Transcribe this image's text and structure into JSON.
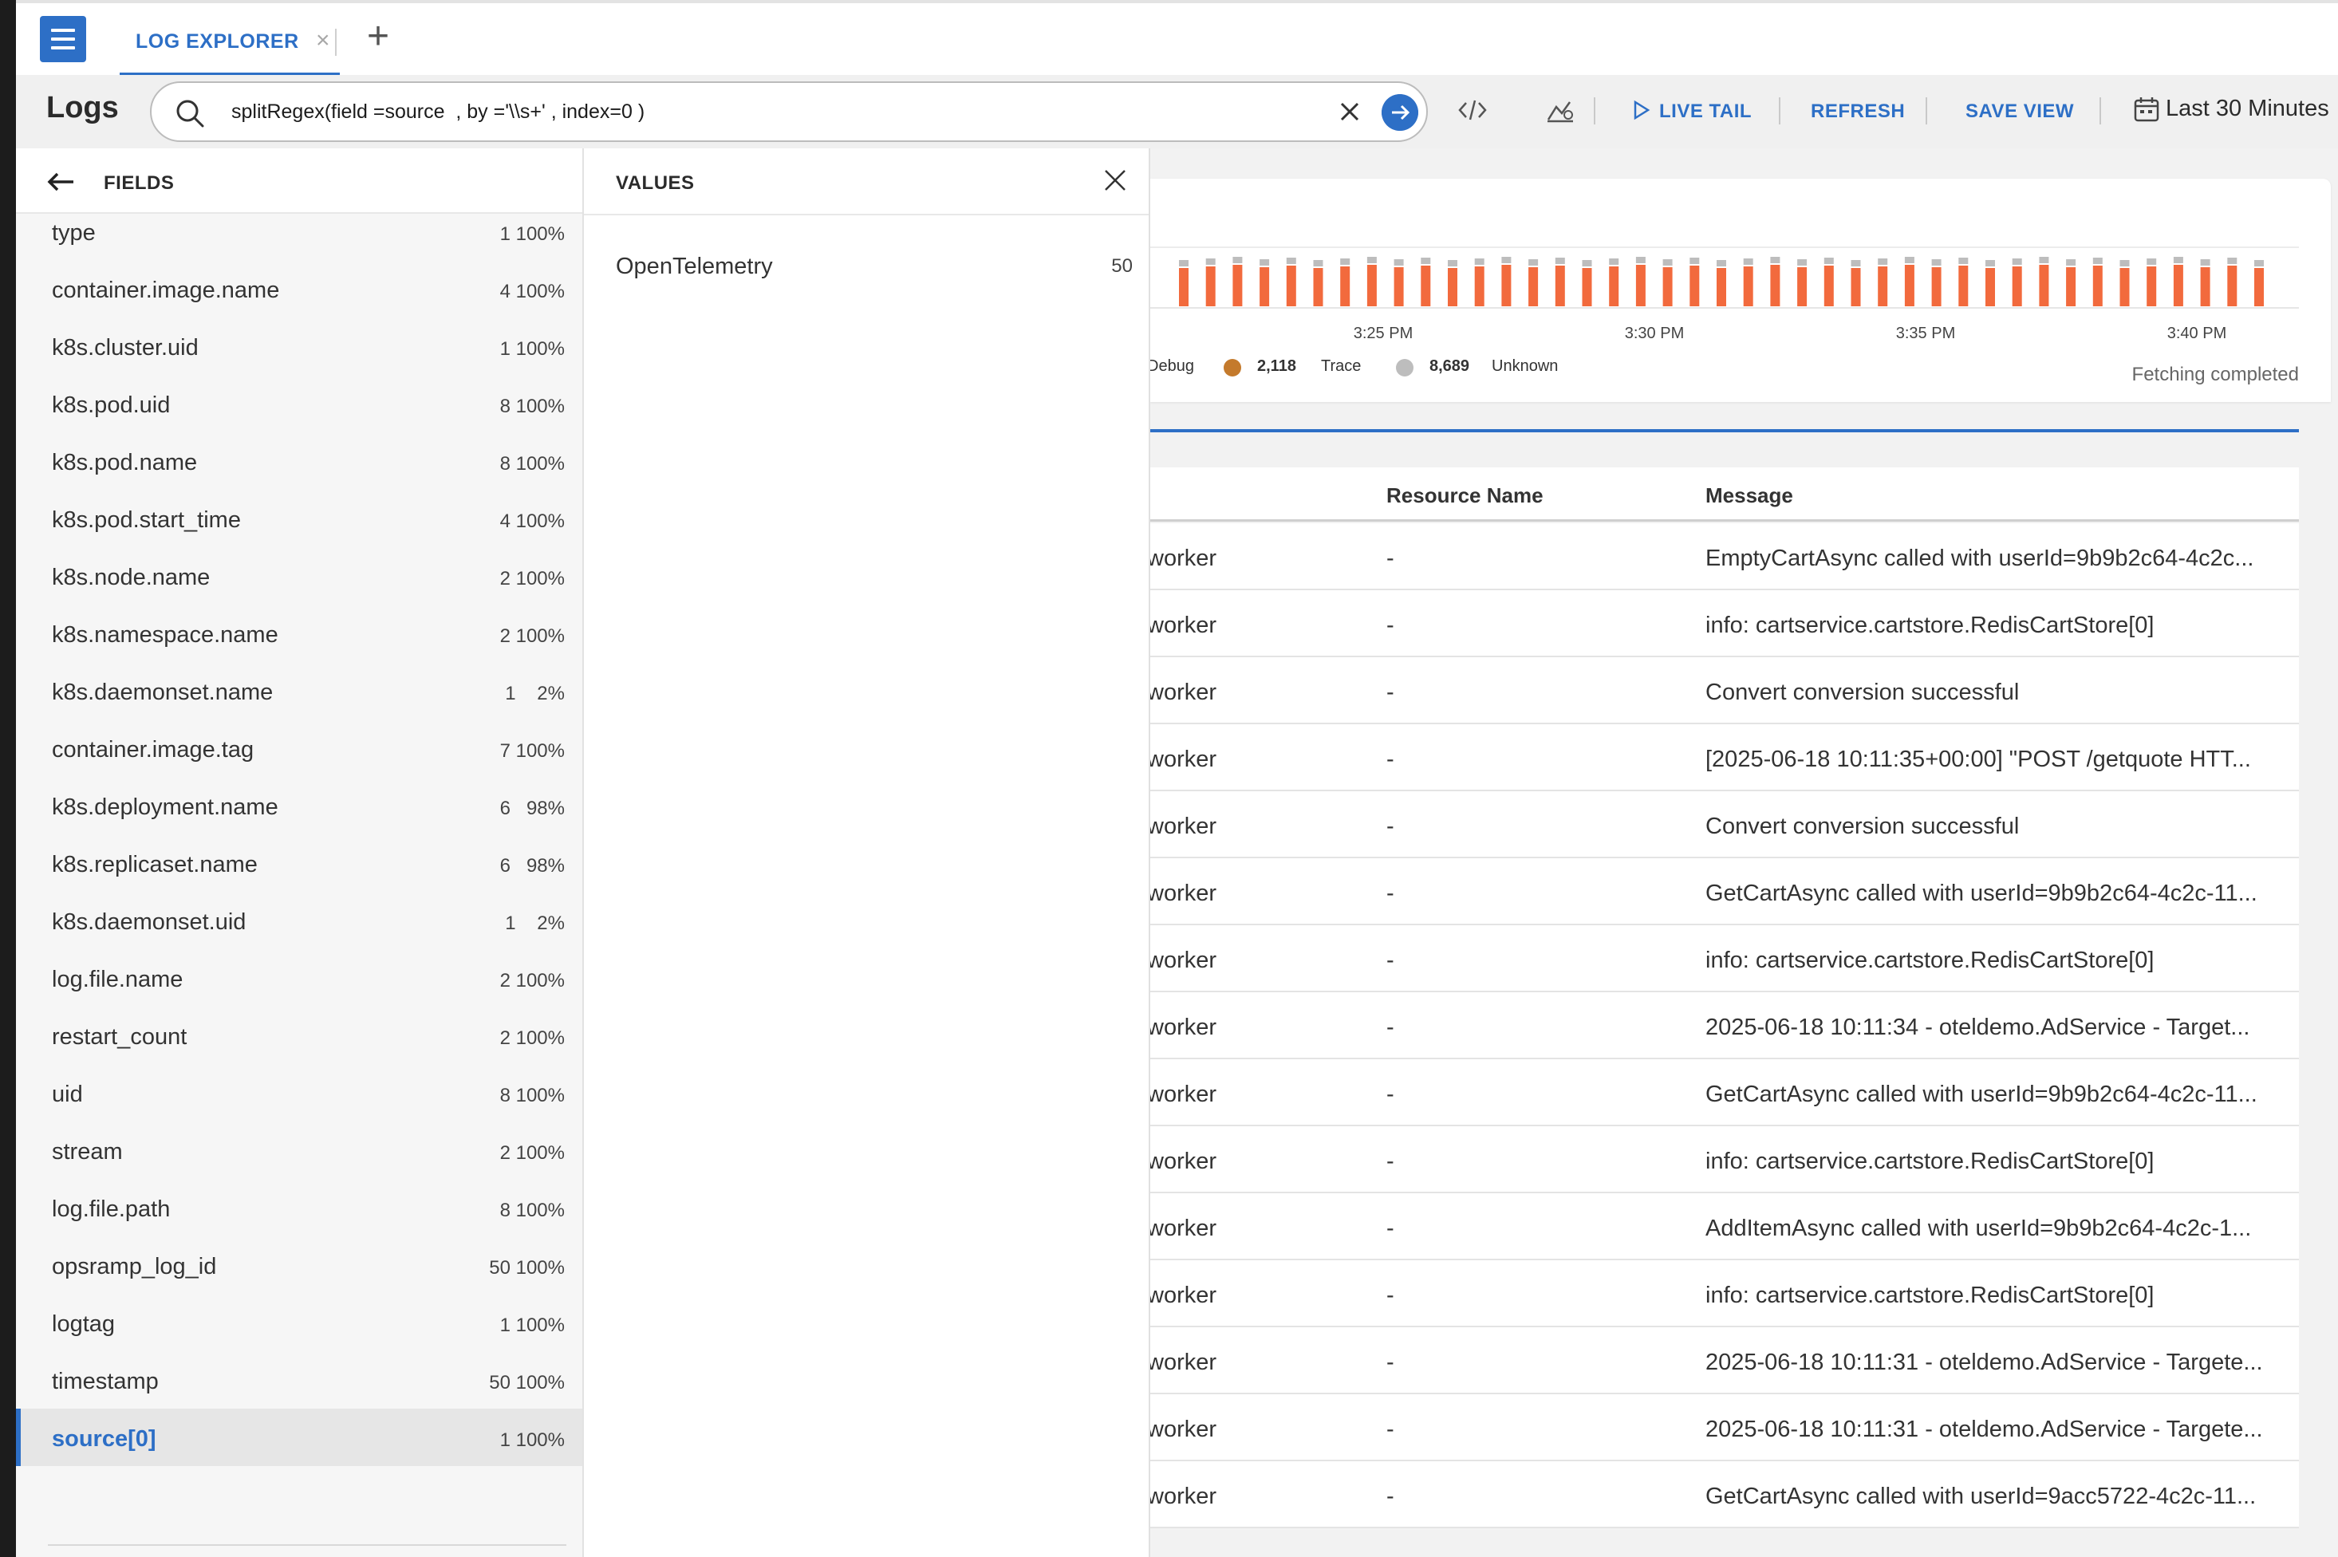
{
  "tab": {
    "label": "LOG EXPLORER",
    "close_glyph": "×",
    "add_glyph": "+"
  },
  "toolbar": {
    "title": "Logs",
    "query": "splitRegex(field =source  , by ='\\\\s+' , index=0 )",
    "code_icon": "code-icon",
    "chart_icon": "chart-settings-icon",
    "live_tail": "LIVE TAIL",
    "refresh": "REFRESH",
    "save_view": "SAVE VIEW",
    "time_range": "Last 30 Minutes"
  },
  "fields_panel": {
    "title": "FIELDS",
    "items": [
      {
        "name": "type",
        "stat": "1 100%"
      },
      {
        "name": "container.image.name",
        "stat": "4 100%"
      },
      {
        "name": "k8s.cluster.uid",
        "stat": "1 100%"
      },
      {
        "name": "k8s.pod.uid",
        "stat": "8 100%"
      },
      {
        "name": "k8s.pod.name",
        "stat": "8 100%"
      },
      {
        "name": "k8s.pod.start_time",
        "stat": "4 100%"
      },
      {
        "name": "k8s.node.name",
        "stat": "2 100%"
      },
      {
        "name": "k8s.namespace.name",
        "stat": "2 100%"
      },
      {
        "name": "k8s.daemonset.name",
        "stat": "1    2%"
      },
      {
        "name": "container.image.tag",
        "stat": "7 100%"
      },
      {
        "name": "k8s.deployment.name",
        "stat": "6   98%"
      },
      {
        "name": "k8s.replicaset.name",
        "stat": "6   98%"
      },
      {
        "name": "k8s.daemonset.uid",
        "stat": "1    2%"
      },
      {
        "name": "log.file.name",
        "stat": "2 100%"
      },
      {
        "name": "restart_count",
        "stat": "2 100%"
      },
      {
        "name": "uid",
        "stat": "8 100%"
      },
      {
        "name": "stream",
        "stat": "2 100%"
      },
      {
        "name": "log.file.path",
        "stat": "8 100%"
      },
      {
        "name": "opsramp_log_id",
        "stat": "50 100%"
      },
      {
        "name": "logtag",
        "stat": "1 100%"
      },
      {
        "name": "timestamp",
        "stat": "50 100%"
      },
      {
        "name": "source[0]",
        "stat": "1 100%",
        "selected": true
      }
    ]
  },
  "values_panel": {
    "title": "VALUES",
    "items": [
      {
        "value": "OpenTelemetry",
        "count": "50"
      }
    ]
  },
  "chart_data": {
    "type": "bar",
    "x_ticks": [
      "3:25 PM",
      "3:30 PM",
      "3:35 PM",
      "3:40 PM"
    ],
    "legend": [
      {
        "label": "Debug",
        "count": "",
        "color": "#f26a3d"
      },
      {
        "label": "Trace",
        "count": "2,118",
        "color": "#c47a2c"
      },
      {
        "label": "Unknown",
        "count": "8,689",
        "color": "#bdbdbd"
      }
    ],
    "series_colors": {
      "primary": "#f26a3d",
      "secondary": "#bdbdbd"
    },
    "bar_count": 41,
    "status": "Fetching completed"
  },
  "log_table": {
    "columns": [
      "Resource Name",
      "Message"
    ],
    "rows": [
      {
        "source": "worker",
        "resource": "-",
        "message": "EmptyCartAsync called with userId=9b9b2c64-4c2c..."
      },
      {
        "source": "worker",
        "resource": "-",
        "message": "info: cartservice.cartstore.RedisCartStore[0]"
      },
      {
        "source": "worker",
        "resource": "-",
        "message": "Convert conversion successful"
      },
      {
        "source": "worker",
        "resource": "-",
        "message": "[2025-06-18 10:11:35+00:00] \"POST /getquote HTT..."
      },
      {
        "source": "worker",
        "resource": "-",
        "message": "Convert conversion successful"
      },
      {
        "source": "worker",
        "resource": "-",
        "message": "GetCartAsync called with userId=9b9b2c64-4c2c-11..."
      },
      {
        "source": "worker",
        "resource": "-",
        "message": "info: cartservice.cartstore.RedisCartStore[0]"
      },
      {
        "source": "worker",
        "resource": "-",
        "message": "2025-06-18 10:11:34 - oteldemo.AdService - Target..."
      },
      {
        "source": "worker",
        "resource": "-",
        "message": "GetCartAsync called with userId=9b9b2c64-4c2c-11..."
      },
      {
        "source": "worker",
        "resource": "-",
        "message": "info: cartservice.cartstore.RedisCartStore[0]"
      },
      {
        "source": "worker",
        "resource": "-",
        "message": "AddItemAsync called with userId=9b9b2c64-4c2c-1..."
      },
      {
        "source": "worker",
        "resource": "-",
        "message": "info: cartservice.cartstore.RedisCartStore[0]"
      },
      {
        "source": "worker",
        "resource": "-",
        "message": "2025-06-18 10:11:31 - oteldemo.AdService - Targete..."
      },
      {
        "source": "worker",
        "resource": "-",
        "message": "2025-06-18 10:11:31 - oteldemo.AdService - Targete..."
      },
      {
        "source": "worker",
        "resource": "-",
        "message": "GetCartAsync called with userId=9acc5722-4c2c-11..."
      }
    ]
  },
  "colors": {
    "accent": "#2d6fc6",
    "bar": "#f26a3d",
    "bar_top": "#bdbdbd"
  }
}
